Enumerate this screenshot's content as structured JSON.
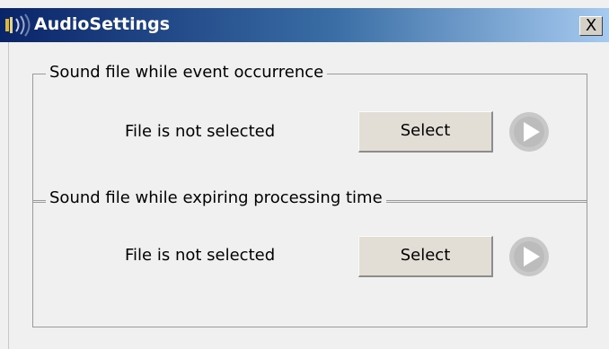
{
  "window": {
    "title": "AudioSettings",
    "close_label": "X",
    "icon": "speaker-icon"
  },
  "groups": [
    {
      "legend": "Sound file while event occurrence",
      "status": "File is not selected",
      "select_label": "Select",
      "play_icon": "play-icon",
      "play_enabled": false
    },
    {
      "legend": "Sound file while expiring processing time",
      "status": "File is not selected",
      "select_label": "Select",
      "play_icon": "play-icon",
      "play_enabled": false
    }
  ],
  "colors": {
    "titlebar_start": "#0a246a",
    "titlebar_end": "#a6caf0",
    "client_bg": "#f0f0f0",
    "button_face": "#e3ded5",
    "play_disabled": "#c8c8c8"
  }
}
